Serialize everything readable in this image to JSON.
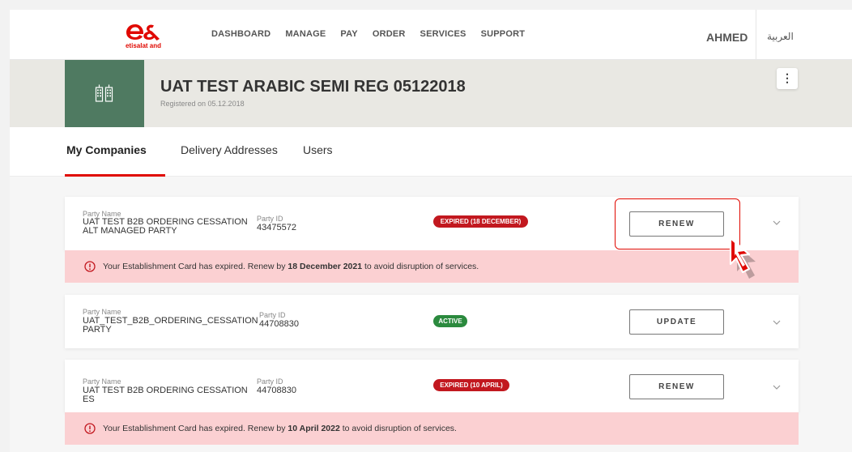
{
  "header": {
    "logo_text": "etisalat and",
    "nav": [
      "DASHBOARD",
      "MANAGE",
      "PAY",
      "ORDER",
      "SERVICES",
      "SUPPORT"
    ],
    "user_name": "AHMED",
    "language": "العربية"
  },
  "company": {
    "name": "UAT TEST ARABIC SEMI REG 05122018",
    "registered": "Registered on  05.12.2018",
    "more_icon": "kebab-menu-icon"
  },
  "tabs": [
    {
      "label": "My Companies",
      "active": true
    },
    {
      "label": "Delivery Addresses",
      "active": false
    },
    {
      "label": "Users",
      "active": false
    }
  ],
  "labels": {
    "party_name": "Party Name",
    "party_id": "Party ID"
  },
  "parties": [
    {
      "name": "UAT TEST B2B ORDERING CESSATION ALT MANAGED PARTY",
      "id": "43475572",
      "status": "EXPIRED (18 DECEMBER)",
      "action": "RENEW"
    },
    {
      "name": "UAT_TEST_B2B_ORDERING_CESSATION PARTY",
      "id": "44708830",
      "status": "ACTIVE",
      "action": "UPDATE"
    },
    {
      "name": "UAT TEST B2B ORDERING CESSATION ES",
      "id": "44708830",
      "status": "EXPIRED (10 APRIL)",
      "action": "RENEW"
    }
  ],
  "alerts": [
    {
      "pre": "Your Establishment Card has expired. Renew by ",
      "date": "18 December 2021",
      "post": " to avoid disruption of services."
    },
    {
      "pre": "Your Establishment Card has expired. Renew by ",
      "date": "10 April 2022",
      "post": " to avoid disruption of services."
    }
  ],
  "colors": {
    "brand_red": "#e00800",
    "company_tile": "#4f7a61",
    "expired": "#c2181f",
    "active": "#2b8a3e",
    "alert_bg": "#fbd0d2"
  }
}
